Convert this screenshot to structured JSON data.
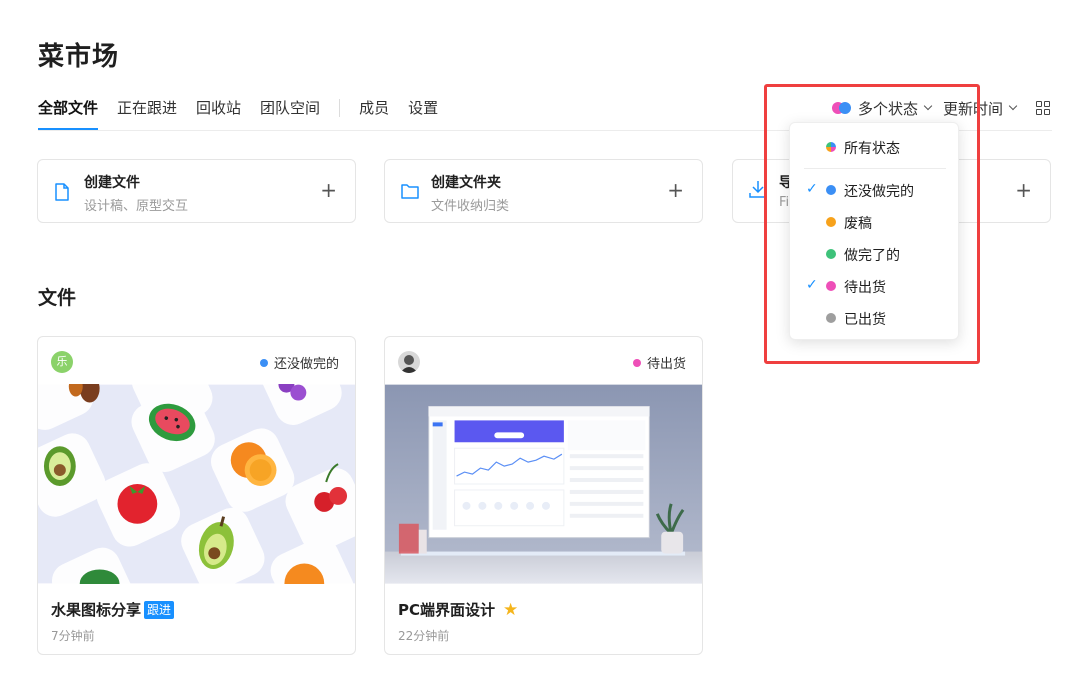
{
  "app": {
    "title": "菜市场"
  },
  "nav": {
    "tabs": [
      "全部文件",
      "正在跟进",
      "回收站",
      "团队空间"
    ],
    "extra": [
      "成员",
      "设置"
    ]
  },
  "toolbar": {
    "status_label": "多个状态",
    "sort_label": "更新时间"
  },
  "actions": [
    {
      "title": "创建文件",
      "subtitle": "设计稿、原型交互"
    },
    {
      "title": "创建文件夹",
      "subtitle": "文件收纳归类"
    },
    {
      "title": "导",
      "subtitle": "Fi"
    }
  ],
  "section": {
    "files_title": "文件"
  },
  "files": [
    {
      "avatar_text": "乐",
      "status": "还没做完的",
      "status_color": "#3b8ff5",
      "name": "水果图标分享",
      "tag": "跟进",
      "time": "7分钟前"
    },
    {
      "status": "待出货",
      "status_color": "#ee4fb8",
      "name": "PC端界面设计",
      "starred": true,
      "time": "22分钟前"
    }
  ],
  "dropdown": {
    "items": [
      {
        "label": "所有状态",
        "color": "rainbow",
        "checked": false
      },
      {
        "label": "还没做完的",
        "color": "#3b8ff5",
        "checked": true
      },
      {
        "label": "废稿",
        "color": "#f7a21b",
        "checked": false
      },
      {
        "label": "做完了的",
        "color": "#3ec27a",
        "checked": false
      },
      {
        "label": "待出货",
        "color": "#ee4fb8",
        "checked": true
      },
      {
        "label": "已出货",
        "color": "#9e9e9e",
        "checked": false
      }
    ]
  },
  "icons": {
    "check": "✓",
    "plus": "+",
    "star": "★"
  }
}
